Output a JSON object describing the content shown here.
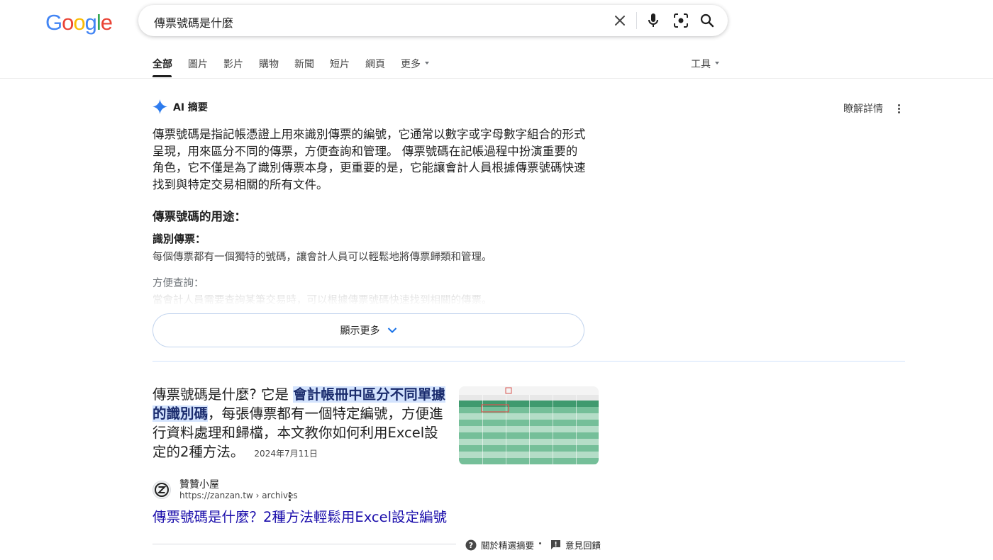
{
  "header": {
    "logo_text": [
      "G",
      "o",
      "o",
      "g",
      "l",
      "e"
    ],
    "logo_colors": [
      "#4285F4",
      "#EA4335",
      "#FBBC05",
      "#4285F4",
      "#34A853",
      "#EA4335"
    ],
    "search_query": "傳票號碼是什麼"
  },
  "tabs": [
    {
      "label": "全部",
      "active": true
    },
    {
      "label": "圖片"
    },
    {
      "label": "影片"
    },
    {
      "label": "購物"
    },
    {
      "label": "新聞"
    },
    {
      "label": "短片"
    },
    {
      "label": "網頁"
    },
    {
      "label": "更多"
    }
  ],
  "tools_label": "工具",
  "ai_overview": {
    "title": "AI 摘要",
    "learn_more": "瞭解詳情",
    "paragraph": "傳票號碼是指記帳憑證上用來識別傳票的編號，它通常以數字或字母數字組合的形式呈現，用來區分不同的傳票，方便查詢和管理。 傳票號碼在記帳過程中扮演重要的角色，它不僅是為了識別傳票本身，更重要的是，它能讓會計人員根據傳票號碼快速找到與特定交易相關的所有文件。",
    "heading": "傳票號碼的用途：",
    "item1_title": "識別傳票：",
    "item1_text": "每個傳票都有一個獨特的號碼，讓會計人員可以輕鬆地將傳票歸類和管理。",
    "item2_title": "方便查詢：",
    "item2_text": "當會計人員需要查詢某筆交易時，可以根據傳票號碼快速找到相關的傳票。",
    "show_more": "顯示更多"
  },
  "featured_snippet": {
    "text_before": "傳票號碼是什麼?  它是 ",
    "highlight": "會計帳冊中區分不同單據的識別碼",
    "text_after": "，每張傳票都有一個特定編號，方便進行資料處理和歸檔，本文教你如何利用Excel設定的2種方法。",
    "date": "2024年7月11日",
    "site_icon_letter": "Z",
    "site_name": "贊贊小屋",
    "site_url": "https://zanzan.tw › archives",
    "title": "傳票號碼是什麼？2種方法輕鬆用Excel設定編號"
  },
  "footer": {
    "about": "關於精選摘要",
    "feedback": "意見回饋"
  },
  "colors": {
    "link": "#1a0dab",
    "highlight_bg": "#d3e3fd",
    "thumb_green": "#5fb58a",
    "gemini_blue": "#4285F4"
  }
}
